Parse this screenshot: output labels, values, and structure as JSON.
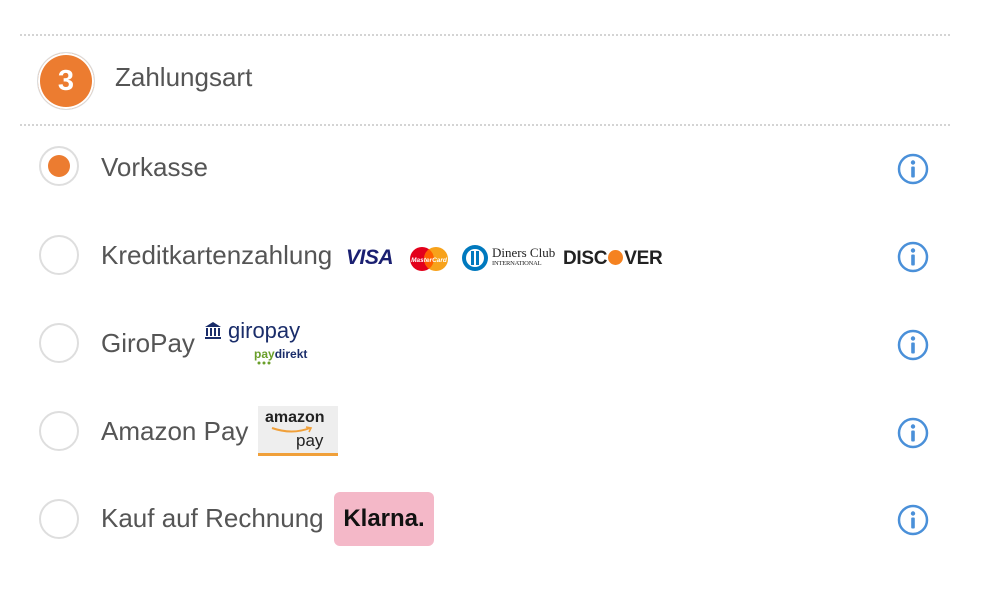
{
  "section": {
    "step_number": "3",
    "title": "Zahlungsart"
  },
  "payment_options": [
    {
      "label": "Vorkasse",
      "selected": true
    },
    {
      "label": "Kreditkartenzahlung",
      "selected": false
    },
    {
      "label": "GiroPay",
      "selected": false
    },
    {
      "label": "Amazon Pay",
      "selected": false
    },
    {
      "label": "Kauf auf Rechnung",
      "selected": false
    }
  ],
  "card_logos": {
    "visa": "VISA",
    "mastercard": "MasterCard",
    "diners_line1": "Diners Club",
    "diners_line2": "INTERNATIONAL",
    "discover_pre": "DISC",
    "discover_post": "VER"
  },
  "giropay_logo": {
    "word": "giropay",
    "sub_pay": "pay",
    "sub_direkt": "direkt"
  },
  "amazon_logo": {
    "line1": "amazon",
    "line2": "pay"
  },
  "klarna_logo": "Klarna.",
  "icons": {
    "info": "info-circle-icon"
  },
  "colors": {
    "accent": "#ec7c30",
    "info_blue": "#4a90d9",
    "klarna_pink": "#f4b8c8"
  }
}
